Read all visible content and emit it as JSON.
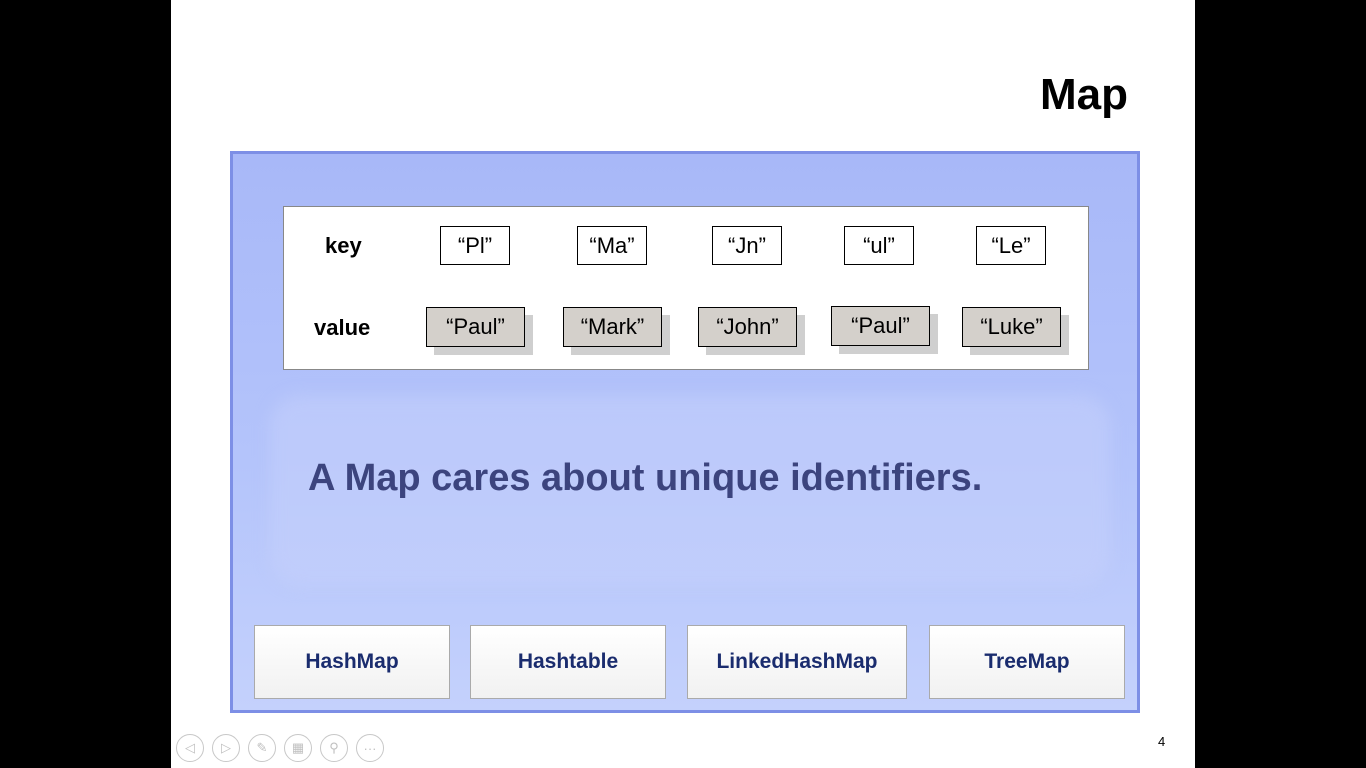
{
  "slide": {
    "title": "Map",
    "page_number": "4"
  },
  "table": {
    "key_label": "key",
    "value_label": "value",
    "keys": [
      "“Pl”",
      "“Ma”",
      "“Jn”",
      "“ul”",
      "“Le”"
    ],
    "values": [
      "“Paul”",
      "“Mark”",
      "“John”",
      "“Paul”",
      "“Luke”"
    ]
  },
  "statement": "A Map cares about unique identifiers.",
  "implementations": [
    "HashMap",
    "Hashtable",
    "LinkedHashMap",
    "TreeMap"
  ],
  "controls": {
    "icons": [
      "previous-slide-icon",
      "next-slide-icon",
      "pen-icon",
      "slide-sorter-icon",
      "zoom-icon",
      "more-options-icon"
    ],
    "glyphs": [
      "◁",
      "▷",
      "✎",
      "▦",
      "⚲",
      "···"
    ]
  },
  "colors": {
    "panel_border": "#7d8fe6",
    "panel_fill": "#b4c4fb",
    "statement_text": "#3c447e",
    "impl_text": "#1a2c6e",
    "value_cell_fill": "#d4d0cb"
  }
}
